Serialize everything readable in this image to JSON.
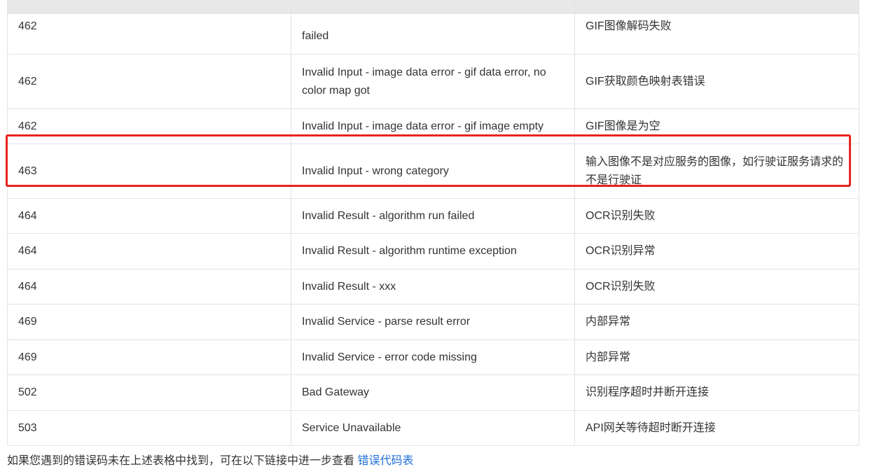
{
  "table": {
    "headers": [
      "",
      "",
      ""
    ],
    "rows": [
      {
        "code": "462",
        "message": "failed",
        "description": "GIF图像解码失败"
      },
      {
        "code": "462",
        "message": "Invalid Input - image data error - gif data error, no color map got",
        "description": "GIF获取颜色映射表错误"
      },
      {
        "code": "462",
        "message": "Invalid Input - image data error - gif image empty",
        "description": "GIF图像是为空"
      },
      {
        "code": "463",
        "message": "Invalid Input - wrong category",
        "description": "输入图像不是对应服务的图像，如行驶证服务请求的不是行驶证"
      },
      {
        "code": "464",
        "message": "Invalid Result - algorithm run failed",
        "description": "OCR识别失败"
      },
      {
        "code": "464",
        "message": "Invalid Result - algorithm runtime exception",
        "description": "OCR识别异常"
      },
      {
        "code": "464",
        "message": "Invalid Result - xxx",
        "description": "OCR识别失败"
      },
      {
        "code": "469",
        "message": "Invalid Service - parse result error",
        "description": "内部异常"
      },
      {
        "code": "469",
        "message": "Invalid Service - error code missing",
        "description": "内部异常"
      },
      {
        "code": "502",
        "message": "Bad Gateway",
        "description": "识别程序超时并断开连接"
      },
      {
        "code": "503",
        "message": "Service Unavailable",
        "description": "API网关等待超时断开连接"
      }
    ]
  },
  "footer_note": {
    "text": "如果您遇到的错误码未在上述表格中找到，可在以下链接中进一步查看",
    "link_label": "错误代码表"
  }
}
